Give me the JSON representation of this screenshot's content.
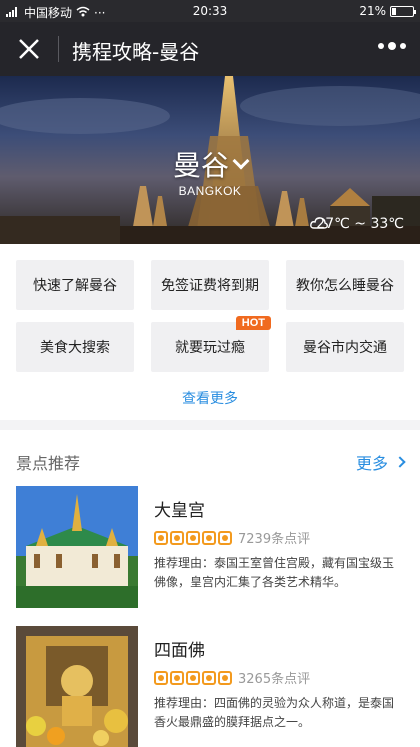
{
  "status_bar": {
    "carrier": "中国移动",
    "time": "20:33",
    "battery": "21%",
    "battery_level": 0.21
  },
  "nav": {
    "title": "携程攻略-曼谷"
  },
  "hero": {
    "city": "曼谷",
    "city_en": "BANGKOK",
    "weather": "27℃ ~ 33℃"
  },
  "quick_links": [
    {
      "label": "快速了解曼谷"
    },
    {
      "label": "免签证费将到期"
    },
    {
      "label": "教你怎么睡曼谷"
    },
    {
      "label": "美食大搜索"
    },
    {
      "label": "就要玩过瘾",
      "badge": "HOT"
    },
    {
      "label": "曼谷市内交通"
    }
  ],
  "see_more": "查看更多",
  "attractions": {
    "title": "景点推荐",
    "more": "更多",
    "items": [
      {
        "name": "大皇宫",
        "reviews": "7239条点评",
        "stars": 5,
        "reason": "推荐理由：泰国王室曾住宫殿，藏有国宝级玉佛像，皇宫内汇集了各类艺术精华。"
      },
      {
        "name": "四面佛",
        "reviews": "3265条点评",
        "stars": 5,
        "reason": "推荐理由：四面佛的灵验为众人称道，是泰国香火最鼎盛的膜拜据点之一。"
      }
    ]
  },
  "colors": {
    "accent": "#2a8ee0",
    "hot": "#f06a1f",
    "star": "#f39a1e",
    "nav_bg": "#25252a"
  }
}
